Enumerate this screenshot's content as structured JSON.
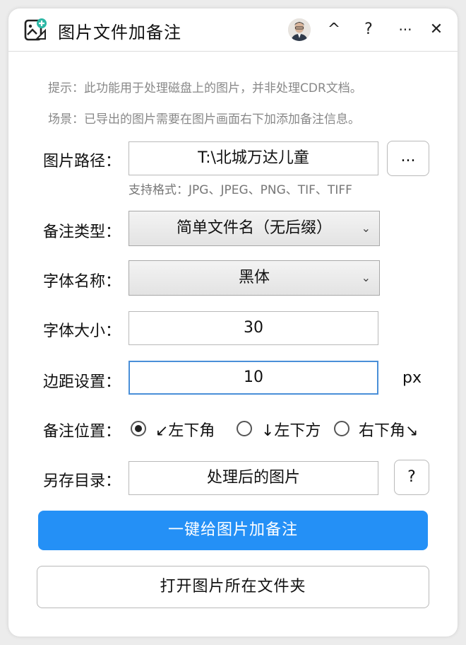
{
  "window": {
    "title": "图片文件加备注",
    "controls": {
      "collapse": "^",
      "help": "?",
      "more": "···",
      "close": "✕"
    }
  },
  "hints": {
    "line1": "提示：此功能用于处理磁盘上的图片，并非处理CDR文档。",
    "line2": "场景：已导出的图片需要在图片画面右下加添加备注信息。"
  },
  "form": {
    "path": {
      "label": "图片路径：",
      "value": "T:\\北城万达儿童",
      "browse": "...",
      "formats": "支持格式：JPG、JPEG、PNG、TIF、TIFF"
    },
    "note_type": {
      "label": "备注类型：",
      "value": "简单文件名（无后缀）"
    },
    "font_name": {
      "label": "字体名称：",
      "value": "黑体"
    },
    "font_size": {
      "label": "字体大小：",
      "value": "30"
    },
    "margin": {
      "label": "边距设置：",
      "value": "10",
      "unit": "px"
    },
    "position": {
      "label": "备注位置：",
      "options": [
        "↙左下角",
        "↓左下方",
        "右下角↘"
      ],
      "selected": "↙左下角"
    },
    "save_dir": {
      "label": "另存目录：",
      "value": "处理后的图片",
      "help": "?"
    }
  },
  "actions": {
    "primary": "一键给图片加备注",
    "secondary": "打开图片所在文件夹"
  }
}
